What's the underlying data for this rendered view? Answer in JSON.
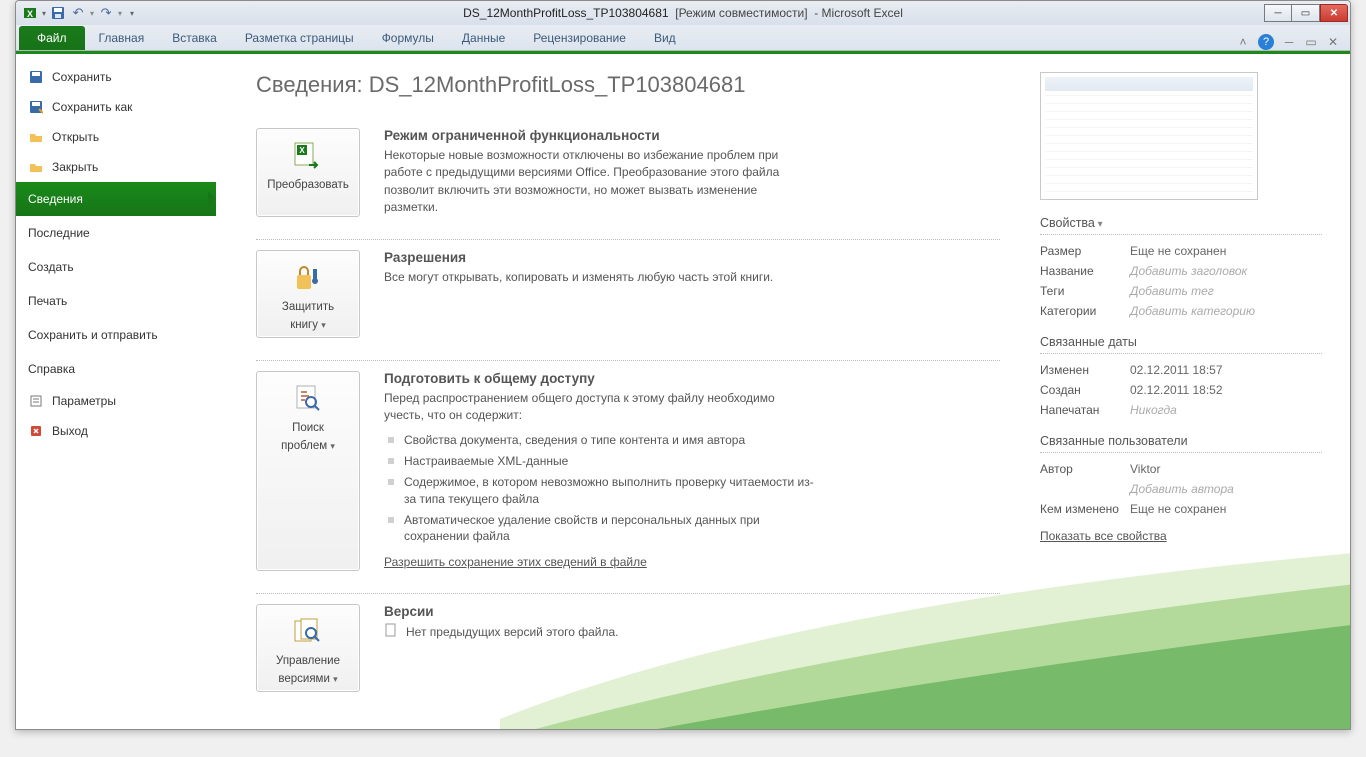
{
  "window": {
    "doc_name": "DS_12MonthProfitLoss_TP103804681",
    "compat": "[Режим совместимости]",
    "app": "Microsoft Excel"
  },
  "ribbon": {
    "file": "Файл",
    "tabs": [
      "Главная",
      "Вставка",
      "Разметка страницы",
      "Формулы",
      "Данные",
      "Рецензирование",
      "Вид"
    ]
  },
  "nav": {
    "save": "Сохранить",
    "save_as": "Сохранить как",
    "open": "Открыть",
    "close": "Закрыть",
    "info": "Сведения",
    "recent": "Последние",
    "new": "Создать",
    "print": "Печать",
    "send": "Сохранить и отправить",
    "help": "Справка",
    "options": "Параметры",
    "exit": "Выход"
  },
  "page": {
    "title_prefix": "Сведения: ",
    "title_doc": "DS_12MonthProfitLoss_TP103804681"
  },
  "s1": {
    "btn": "Преобразовать",
    "title": "Режим ограниченной функциональности",
    "text": "Некоторые новые возможности отключены во избежание проблем при работе с предыдущими версиями Office. Преобразование этого файла позволит включить эти возможности, но может вызвать изменение разметки."
  },
  "s2": {
    "btn_l1": "Защитить",
    "btn_l2": "книгу",
    "title": "Разрешения",
    "text": "Все могут открывать, копировать и изменять любую часть этой книги."
  },
  "s3": {
    "btn_l1": "Поиск",
    "btn_l2": "проблем",
    "title": "Подготовить к общему доступу",
    "text": "Перед распространением общего доступа к этому файлу необходимо учесть, что он содержит:",
    "li1": "Свойства документа, сведения о типе контента и имя автора",
    "li2": "Настраиваемые XML-данные",
    "li3": "Содержимое, в котором невозможно выполнить проверку читаемости из-за типа текущего файла",
    "li4": "Автоматическое удаление свойств и персональных данных при сохранении файла",
    "link": "Разрешить сохранение этих сведений в файле"
  },
  "s4": {
    "btn_l1": "Управление",
    "btn_l2": "версиями",
    "title": "Версии",
    "text": "Нет предыдущих версий этого файла."
  },
  "props": {
    "head": "Свойства",
    "size_k": "Размер",
    "size_v": "Еще не сохранен",
    "title_k": "Название",
    "title_v": "Добавить заголовок",
    "tags_k": "Теги",
    "tags_v": "Добавить тег",
    "cat_k": "Категории",
    "cat_v": "Добавить категорию",
    "dates_head": "Связанные даты",
    "mod_k": "Изменен",
    "mod_v": "02.12.2011 18:57",
    "cre_k": "Создан",
    "cre_v": "02.12.2011 18:52",
    "prn_k": "Напечатан",
    "prn_v": "Никогда",
    "users_head": "Связанные пользователи",
    "auth_k": "Автор",
    "auth_v": "Viktor",
    "add_auth": "Добавить автора",
    "chg_k": "Кем изменено",
    "chg_v": "Еще не сохранен",
    "show_all": "Показать все свойства"
  }
}
